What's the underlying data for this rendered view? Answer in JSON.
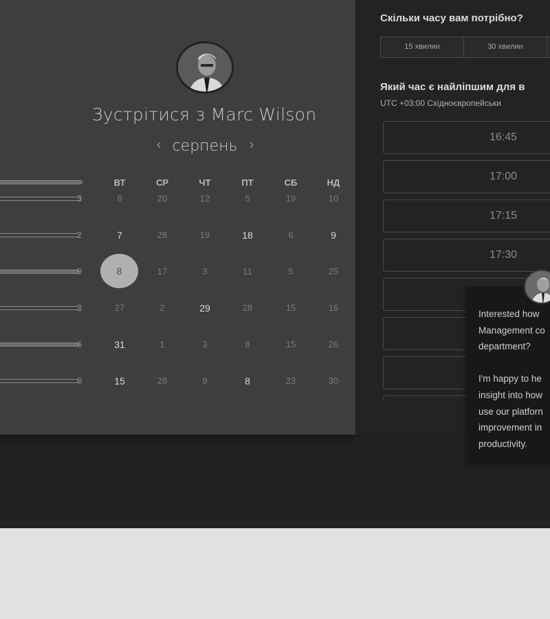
{
  "booking": {
    "title": "Зустрітися з Marc Wilson",
    "prev_month": "‹",
    "next_month": "›",
    "month": "серпень",
    "weekdays": [
      "ВТ",
      "СР",
      "ЧТ",
      "ПТ",
      "СБ",
      "НД"
    ],
    "rows": [
      {
        "tail": "3",
        "days": [
          "8",
          "20",
          "12",
          "5",
          "19",
          "10"
        ],
        "bold": []
      },
      {
        "tail": "2",
        "days": [
          "7",
          "28",
          "19",
          "18",
          "6",
          "9"
        ],
        "bold": [
          0,
          3,
          5
        ]
      },
      {
        "tail": "9",
        "days": [
          "8",
          "17",
          "3",
          "11",
          "5",
          "25"
        ],
        "bold": []
      },
      {
        "tail": "3",
        "days": [
          "27",
          "2",
          "29",
          "28",
          "15",
          "16"
        ],
        "bold": [
          2
        ]
      },
      {
        "tail": "6",
        "days": [
          "31",
          "1",
          "3",
          "8",
          "15",
          "26"
        ],
        "bold": [
          0
        ]
      },
      {
        "tail": "0",
        "days": [
          "15",
          "28",
          "9",
          "8",
          "23",
          "30"
        ],
        "bold": [
          0,
          3
        ]
      }
    ],
    "selected_day": "8"
  },
  "duration": {
    "question": "Скільки часу вам потрібно?",
    "options": [
      "15 хвилин",
      "30 хвилин"
    ]
  },
  "time": {
    "question": "Який час є найліпшим для в",
    "timezone": "UTC +03:00 Східноєвропейськи",
    "slots": [
      "16:45",
      "17:00",
      "17:15",
      "17:30"
    ]
  },
  "chat": {
    "message": "Interested how\nManagement co\ndepartment?\n\nI'm happy to he\ninsight into how\nuse our platforn\nimprovement in\nproductivity."
  },
  "colors": {
    "page_bg": "#e1e1e1",
    "app_bg": "#212121",
    "calendar_panel": "#3e3e3e",
    "selected_day": "#b0b0b0"
  }
}
